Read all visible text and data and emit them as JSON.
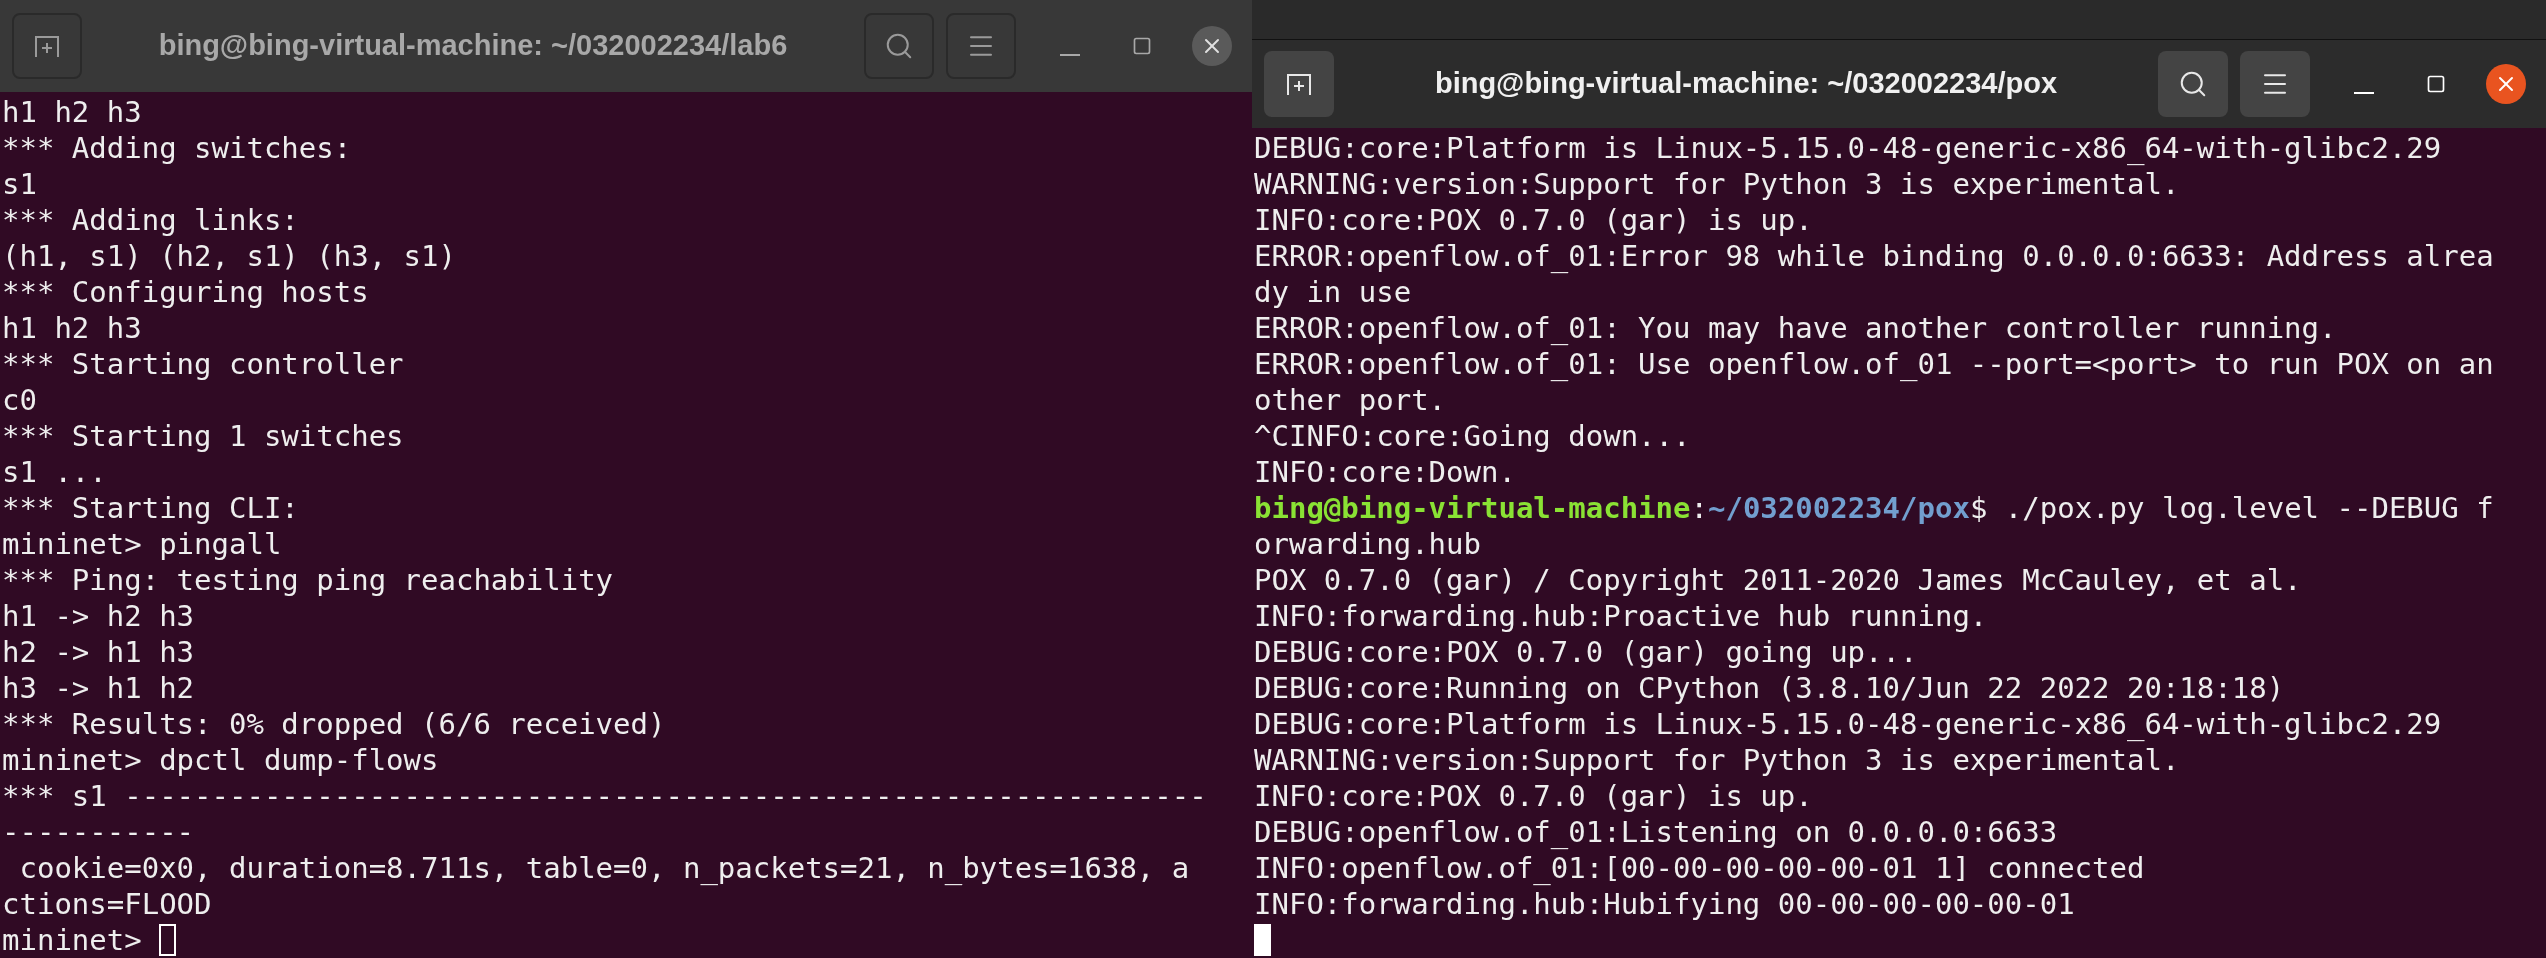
{
  "windows": [
    {
      "title": "bing@bing-virtual-machine: ~/032002234/lab6",
      "focused": false,
      "lines": [
        {
          "kind": "text",
          "text": "h1 h2 h3"
        },
        {
          "kind": "text",
          "text": "*** Adding switches:"
        },
        {
          "kind": "text",
          "text": "s1"
        },
        {
          "kind": "text",
          "text": "*** Adding links:"
        },
        {
          "kind": "text",
          "text": "(h1, s1) (h2, s1) (h3, s1)"
        },
        {
          "kind": "text",
          "text": "*** Configuring hosts"
        },
        {
          "kind": "text",
          "text": "h1 h2 h3"
        },
        {
          "kind": "text",
          "text": "*** Starting controller"
        },
        {
          "kind": "text",
          "text": "c0"
        },
        {
          "kind": "text",
          "text": "*** Starting 1 switches"
        },
        {
          "kind": "text",
          "text": "s1 ..."
        },
        {
          "kind": "text",
          "text": "*** Starting CLI:"
        },
        {
          "kind": "text",
          "text": "mininet> pingall"
        },
        {
          "kind": "text",
          "text": "*** Ping: testing ping reachability"
        },
        {
          "kind": "text",
          "text": "h1 -> h2 h3"
        },
        {
          "kind": "text",
          "text": "h2 -> h1 h3"
        },
        {
          "kind": "text",
          "text": "h3 -> h1 h2"
        },
        {
          "kind": "text",
          "text": "*** Results: 0% dropped (6/6 received)"
        },
        {
          "kind": "text",
          "text": "mininet> dpctl dump-flows"
        },
        {
          "kind": "text",
          "text": "*** s1 --------------------------------------------------------------"
        },
        {
          "kind": "text",
          "text": "-----------"
        },
        {
          "kind": "text",
          "text": " cookie=0x0, duration=8.711s, table=0, n_packets=21, n_bytes=1638, a"
        },
        {
          "kind": "text",
          "text": "ctions=FLOOD"
        },
        {
          "kind": "input",
          "text": "mininet>"
        }
      ]
    },
    {
      "title": "bing@bing-virtual-machine: ~/032002234/pox",
      "focused": true,
      "lines": [
        {
          "kind": "text",
          "text": "DEBUG:core:Platform is Linux-5.15.0-48-generic-x86_64-with-glibc2.29"
        },
        {
          "kind": "text",
          "text": "WARNING:version:Support for Python 3 is experimental."
        },
        {
          "kind": "text",
          "text": "INFO:core:POX 0.7.0 (gar) is up."
        },
        {
          "kind": "text",
          "text": "ERROR:openflow.of_01:Error 98 while binding 0.0.0.0:6633: Address alrea"
        },
        {
          "kind": "text",
          "text": "dy in use"
        },
        {
          "kind": "text",
          "text": "ERROR:openflow.of_01: You may have another controller running."
        },
        {
          "kind": "text",
          "text": "ERROR:openflow.of_01: Use openflow.of_01 --port=<port> to run POX on an"
        },
        {
          "kind": "text",
          "text": "other port."
        },
        {
          "kind": "text",
          "text": "^CINFO:core:Going down..."
        },
        {
          "kind": "text",
          "text": "INFO:core:Down."
        },
        {
          "kind": "prompt",
          "user": "bing@bing-virtual-machine",
          "separator": ":",
          "path": "~/032002234/pox",
          "command": "$ ./pox.py log.level --DEBUG f"
        },
        {
          "kind": "text",
          "text": "orwarding.hub"
        },
        {
          "kind": "text",
          "text": "POX 0.7.0 (gar) / Copyright 2011-2020 James McCauley, et al."
        },
        {
          "kind": "text",
          "text": "INFO:forwarding.hub:Proactive hub running."
        },
        {
          "kind": "text",
          "text": "DEBUG:core:POX 0.7.0 (gar) going up..."
        },
        {
          "kind": "text",
          "text": "DEBUG:core:Running on CPython (3.8.10/Jun 22 2022 20:18:18)"
        },
        {
          "kind": "text",
          "text": "DEBUG:core:Platform is Linux-5.15.0-48-generic-x86_64-with-glibc2.29"
        },
        {
          "kind": "text",
          "text": "WARNING:version:Support for Python 3 is experimental."
        },
        {
          "kind": "text",
          "text": "INFO:core:POX 0.7.0 (gar) is up."
        },
        {
          "kind": "text",
          "text": "DEBUG:openflow.of_01:Listening on 0.0.0.0:6633"
        },
        {
          "kind": "text",
          "text": "INFO:openflow.of_01:[00-00-00-00-00-01 1] connected"
        },
        {
          "kind": "text",
          "text": "INFO:forwarding.hub:Hubifying 00-00-00-00-00-01"
        },
        {
          "kind": "cursor"
        }
      ]
    }
  ]
}
